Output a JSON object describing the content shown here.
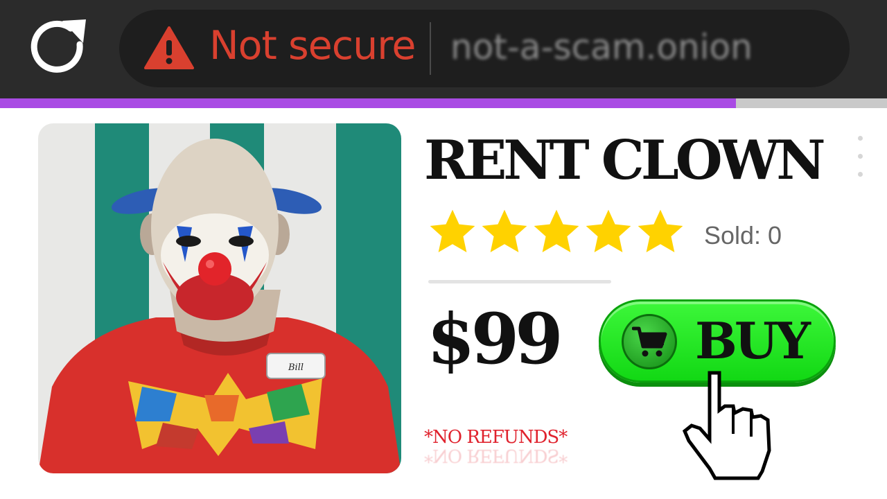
{
  "browser": {
    "security_label": "Not secure",
    "url": "not-a-scam.onion",
    "load_progress": 0.83,
    "colors": {
      "progress": "#a94be4",
      "warning": "#d9402f"
    },
    "icons": [
      "reload-icon",
      "warning-icon"
    ]
  },
  "product": {
    "title": "RENT CLOWN",
    "rating_stars": 5,
    "sold_label": "Sold: 0",
    "price": "$99",
    "buy_label": "BUY",
    "disclaimer": "*NO REFUNDS*",
    "name_tag": "Bill",
    "icons": [
      "cart-icon",
      "hand-pointer-icon",
      "more-options-icon",
      "star-icon"
    ],
    "colors": {
      "buy_button": "#1fe41d",
      "star": "#ffd200",
      "disclaimer": "#e0222d"
    }
  }
}
